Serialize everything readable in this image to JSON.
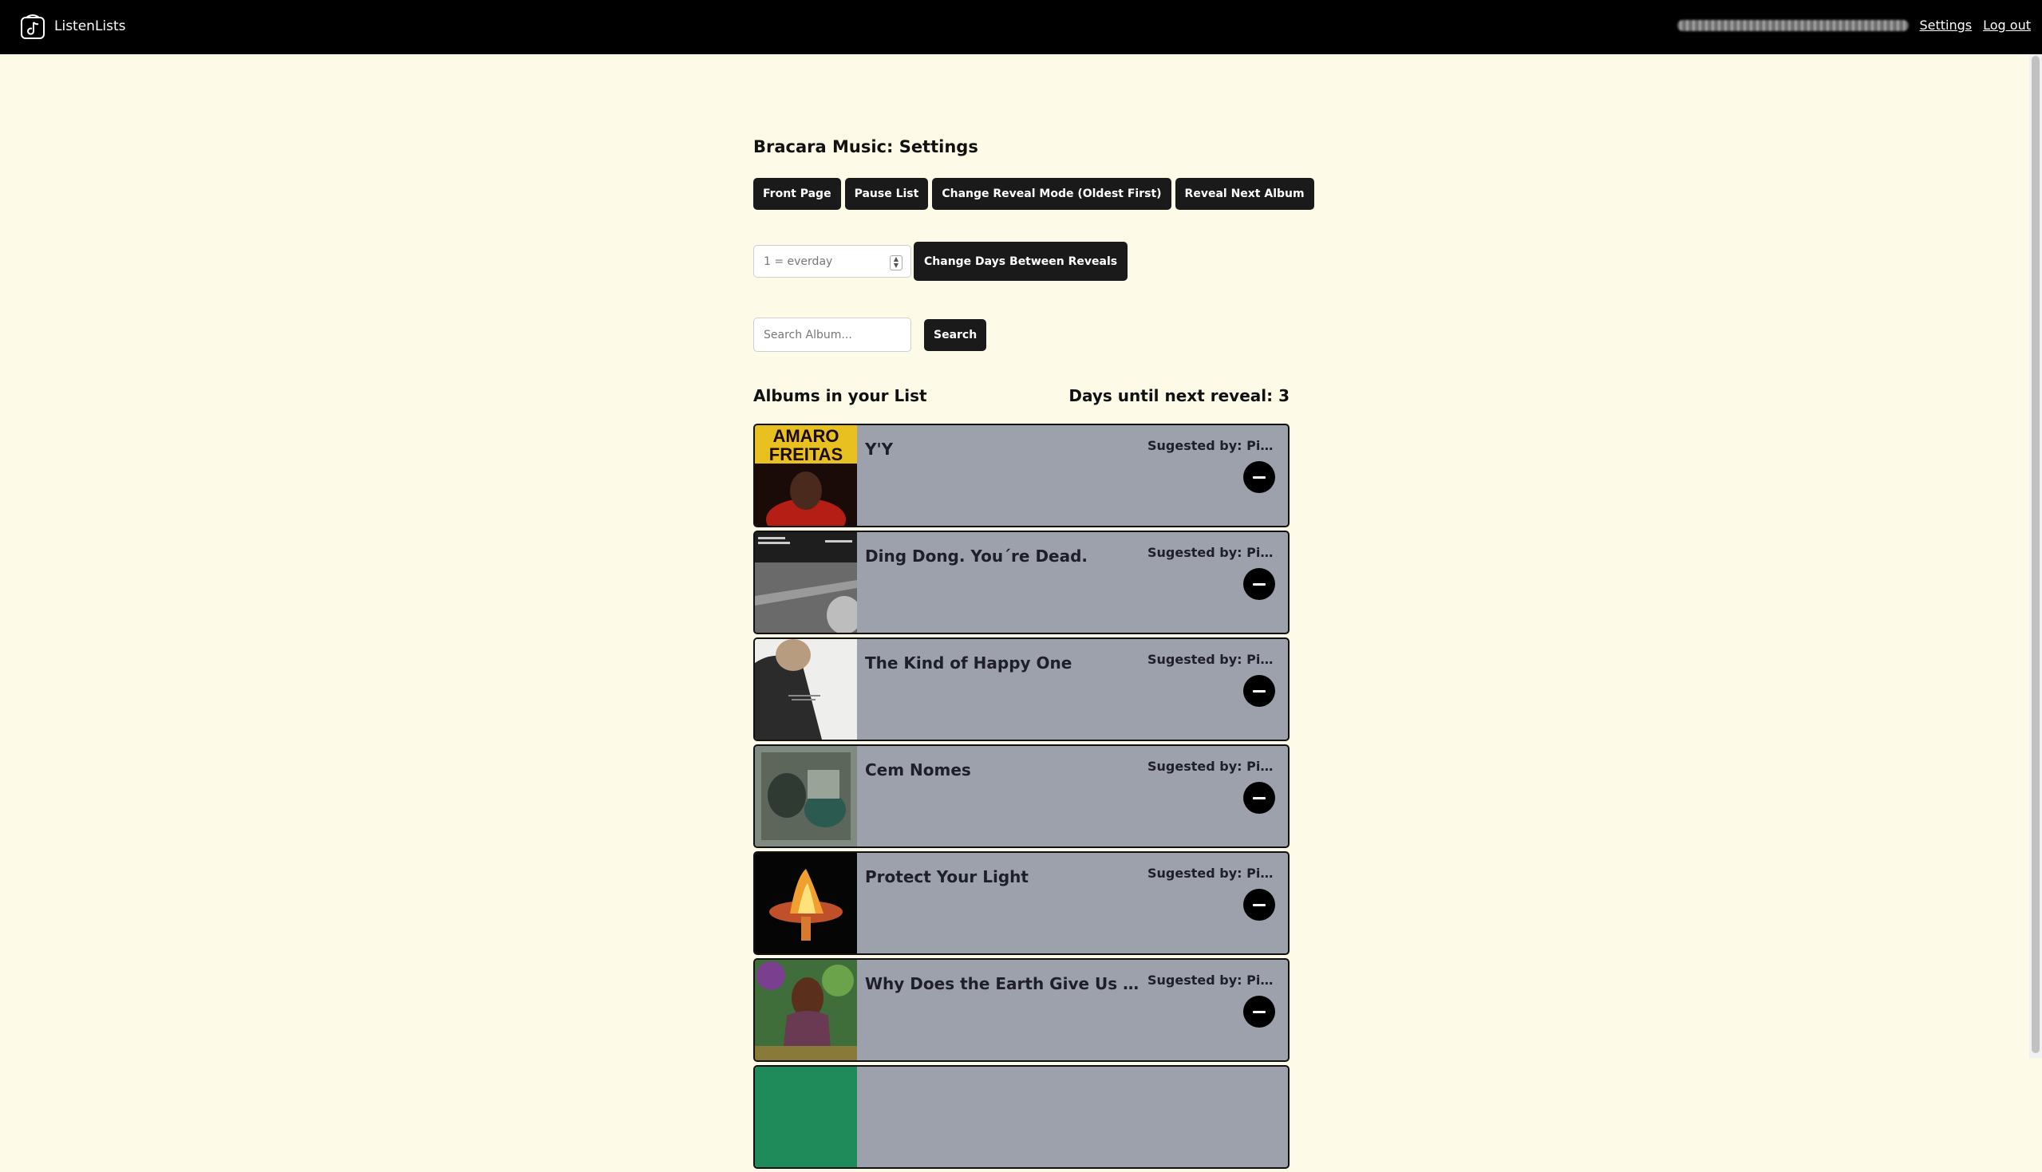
{
  "nav": {
    "brand": "ListenLists",
    "settings": "Settings",
    "logout": "Log out"
  },
  "page": {
    "title": "Bracara Music: Settings"
  },
  "actions": {
    "front_page": "Front Page",
    "pause_list": "Pause List",
    "change_reveal_mode": "Change Reveal Mode (Oldest First)",
    "reveal_next": "Reveal Next Album"
  },
  "days": {
    "placeholder": "1 = everday",
    "button": "Change Days Between Reveals"
  },
  "search": {
    "placeholder": "Search Album...",
    "button": "Search"
  },
  "list": {
    "heading": "Albums in your List",
    "next_reveal": "Days until next reveal: 3",
    "albums": [
      {
        "title": "Y'Y",
        "suggested": "Sugested by: PietroPan"
      },
      {
        "title": "Ding Dong. You´re Dead.",
        "suggested": "Sugested by: PietroPan"
      },
      {
        "title": "The Kind of Happy One",
        "suggested": "Sugested by: PietroPan"
      },
      {
        "title": "Cem Nomes",
        "suggested": "Sugested by: PietroPan"
      },
      {
        "title": "Protect Your Light",
        "suggested": "Sugested by: PietroPan"
      },
      {
        "title": "Why Does the Earth Give Us People to Love?",
        "suggested": "Sugested by: PietroPan"
      },
      {
        "title": "",
        "suggested": ""
      }
    ]
  },
  "covers": {
    "amaro_line1": "AMARO",
    "amaro_line2": "FREITAS"
  }
}
